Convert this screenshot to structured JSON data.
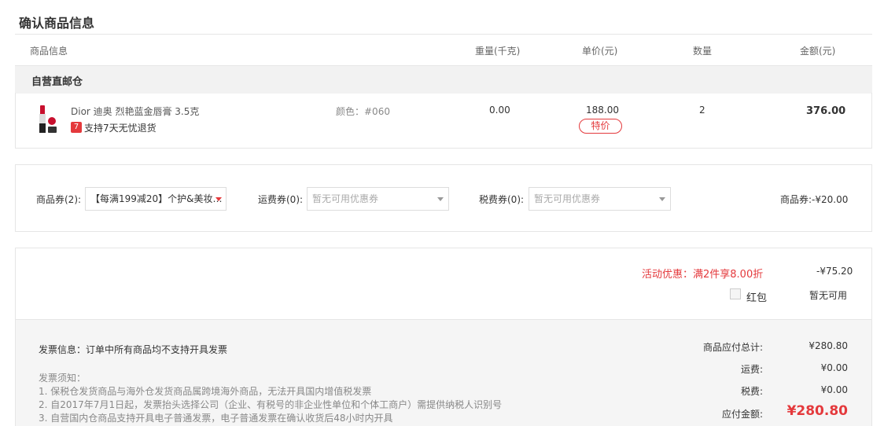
{
  "page": {
    "title": "确认商品信息"
  },
  "table_headers": [
    "商品信息",
    "重量(千克)",
    "单价(元)",
    "数量",
    "金额(元)"
  ],
  "store": {
    "name": "自营直邮仓"
  },
  "item": {
    "name": "Dior 迪奥 烈艳蓝金唇膏 3.5克",
    "return_badge": "7",
    "return_policy": "支持7天无忧退货",
    "color": "颜色：#060",
    "weight": "0.00",
    "unit_price": "188.00",
    "price_tag": "特价",
    "quantity": "2",
    "amount": "376.00"
  },
  "coupons": {
    "product": {
      "label": "商品券(2):",
      "selected": "【每满199减20】个护&美妆…"
    },
    "shipping": {
      "label": "运费券(0):",
      "placeholder": "暂无可用优惠券"
    },
    "tax": {
      "label": "税费券(0):",
      "placeholder": "暂无可用优惠券"
    },
    "discount_text": "商品券:-¥20.00"
  },
  "promotion": {
    "label": "活动优惠：满2件享8.00折",
    "amount": "-¥75.20"
  },
  "red_packet": {
    "label": "红包",
    "status": "暂无可用"
  },
  "invoice": {
    "info": "发票信息：订单中所有商品均不支持开具发票",
    "notes_title": "发票须知：",
    "notes": [
      "1. 保税仓发货商品与海外仓发货商品属跨境海外商品，无法开具国内增值税发票",
      "2. 自2017年7月1日起，发票抬头选择公司（企业、有税号的非企业性单位和个体工商户）需提供纳税人识别号",
      "3. 自营国内仓商品支持开具电子普通发票，电子普通发票在确认收货后48小时内开具"
    ]
  },
  "totals": {
    "subtotal_label": "商品应付总计:",
    "subtotal": "¥280.80",
    "shipping_label": "运费:",
    "shipping": "¥0.00",
    "tax_label": "税费:",
    "tax": "¥0.00",
    "payable_label": "应付金额:",
    "payable": "¥280.80"
  },
  "colors": {
    "accent": "#e4393c",
    "border": "#e6e6e6",
    "panel": "#f5f5f5"
  }
}
